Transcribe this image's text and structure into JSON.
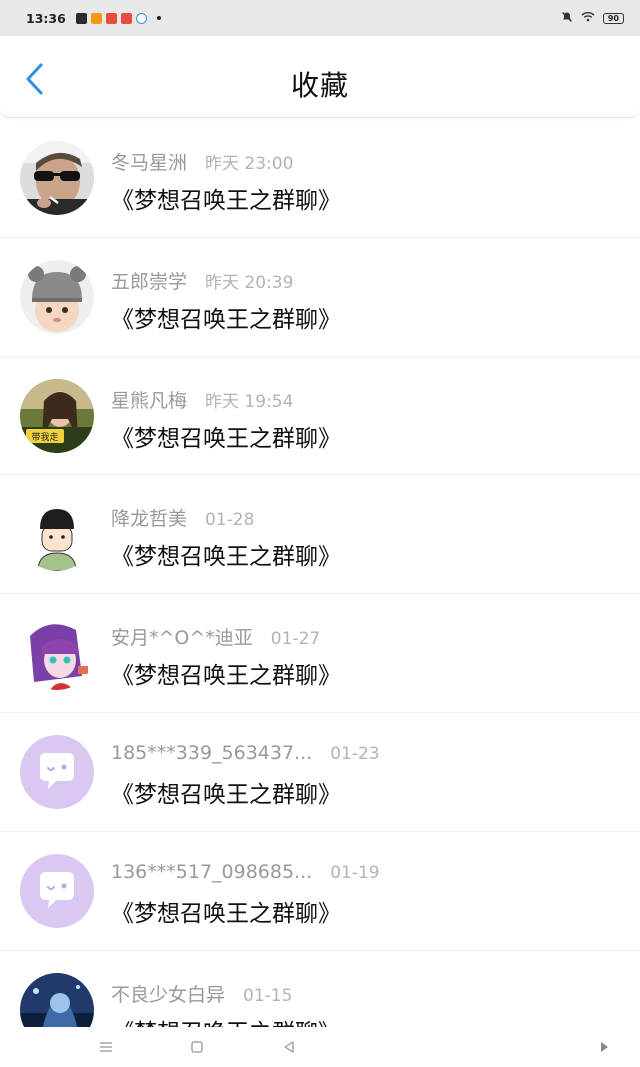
{
  "status_bar": {
    "time": "13:36",
    "battery": "90",
    "notification_colors": [
      "#c0392b",
      "#e67e22",
      "#e74c3c",
      "#d35400",
      "#3498db"
    ]
  },
  "header": {
    "title": "收藏",
    "back_icon": "chevron-left-icon",
    "accent": "#2d8ee6"
  },
  "favorites": [
    {
      "name": "冬马星洲",
      "time": "昨天 23:00",
      "message": "《梦想召唤王之群聊》",
      "avatar": "photo-man-sunglasses"
    },
    {
      "name": "五郎崇学",
      "time": "昨天 20:39",
      "message": "《梦想召唤王之群聊》",
      "avatar": "photo-baby-hat"
    },
    {
      "name": "星熊凡梅",
      "time": "昨天 19:54",
      "message": "《梦想召唤王之群聊》",
      "avatar": "photo-girl-sign"
    },
    {
      "name": "降龙哲美",
      "time": "01-28",
      "message": "《梦想召唤王之群聊》",
      "avatar": "cartoon-boy"
    },
    {
      "name": "安月*^O^*迪亚",
      "time": "01-27",
      "message": "《梦想召唤王之群聊》",
      "avatar": "anime-purple-girl"
    },
    {
      "name": "185***339_563437...",
      "time": "01-23",
      "message": "《梦想召唤王之群聊》",
      "avatar": "default-chat-bubble"
    },
    {
      "name": "136***517_098685...",
      "time": "01-19",
      "message": "《梦想召唤王之群聊》",
      "avatar": "default-chat-bubble"
    },
    {
      "name": "不良少女白异",
      "time": "01-15",
      "message": "《梦想召唤王之群聊》",
      "avatar": "anime-dark-blue"
    }
  ],
  "avatar_texts": {
    "sign": "带我走"
  },
  "nav_bar": {
    "menu_icon": "menu-icon",
    "home_icon": "home-square-icon",
    "back_icon": "back-triangle-icon",
    "extra_icon": "play-triangle-icon"
  }
}
